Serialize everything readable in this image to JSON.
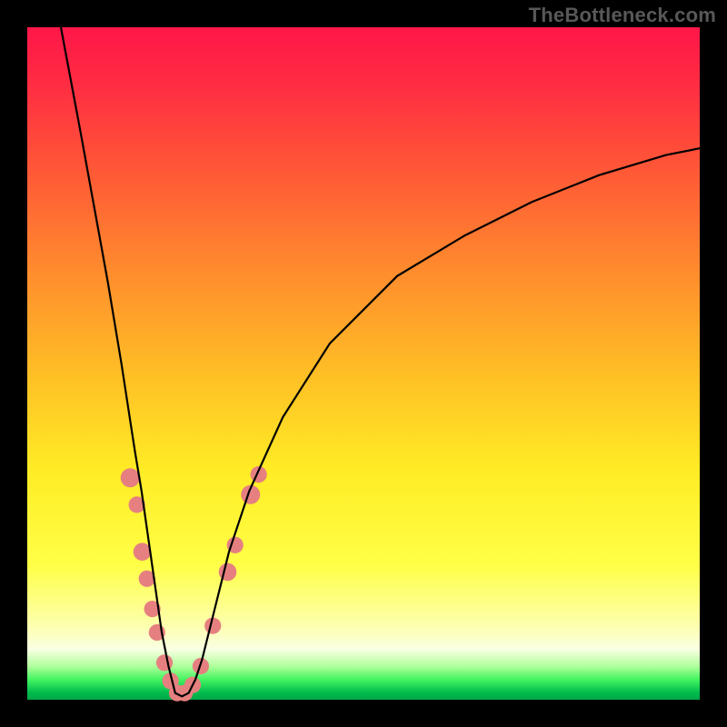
{
  "watermark": "TheBottleneck.com",
  "colors": {
    "blob": "#e68080",
    "curve": "#000000",
    "frame": "#000000"
  },
  "chart_data": {
    "type": "line",
    "title": "",
    "xlabel": "",
    "ylabel": "",
    "xlim": [
      0,
      100
    ],
    "ylim": [
      0,
      100
    ],
    "grid": false,
    "legend": false,
    "description": "V-shaped bottleneck curve over rainbow gradient; minimum near x≈22.5. Background color encodes bottleneck severity (red high → green low).",
    "series": [
      {
        "name": "bottleneck_curve",
        "x": [
          5,
          8,
          10,
          12,
          14,
          16,
          17,
          18,
          19,
          20,
          21,
          22,
          23,
          24,
          25,
          26,
          28,
          30,
          33,
          38,
          45,
          55,
          65,
          75,
          85,
          95,
          100
        ],
        "y": [
          100,
          84,
          73,
          62,
          50,
          37,
          31,
          24,
          17,
          10,
          5,
          1,
          0.5,
          1,
          3,
          6,
          14,
          22,
          31,
          42,
          53,
          63,
          69,
          74,
          78,
          81,
          82
        ]
      }
    ],
    "blobs_normalized": [
      {
        "x": 15.3,
        "y": 33.0,
        "r": 1.5
      },
      {
        "x": 16.3,
        "y": 29.0,
        "r": 1.3
      },
      {
        "x": 17.1,
        "y": 22.0,
        "r": 1.4
      },
      {
        "x": 17.8,
        "y": 18.0,
        "r": 1.3
      },
      {
        "x": 18.6,
        "y": 13.5,
        "r": 1.3
      },
      {
        "x": 19.3,
        "y": 10.0,
        "r": 1.3
      },
      {
        "x": 20.4,
        "y": 5.5,
        "r": 1.3
      },
      {
        "x": 21.3,
        "y": 2.8,
        "r": 1.3
      },
      {
        "x": 22.3,
        "y": 1.0,
        "r": 1.3
      },
      {
        "x": 23.4,
        "y": 1.0,
        "r": 1.3
      },
      {
        "x": 24.6,
        "y": 2.2,
        "r": 1.3
      },
      {
        "x": 25.8,
        "y": 5.0,
        "r": 1.3
      },
      {
        "x": 27.6,
        "y": 11.0,
        "r": 1.3
      },
      {
        "x": 29.8,
        "y": 19.0,
        "r": 1.4
      },
      {
        "x": 30.9,
        "y": 23.0,
        "r": 1.3
      },
      {
        "x": 33.2,
        "y": 30.5,
        "r": 1.5
      },
      {
        "x": 34.4,
        "y": 33.5,
        "r": 1.3
      }
    ]
  }
}
